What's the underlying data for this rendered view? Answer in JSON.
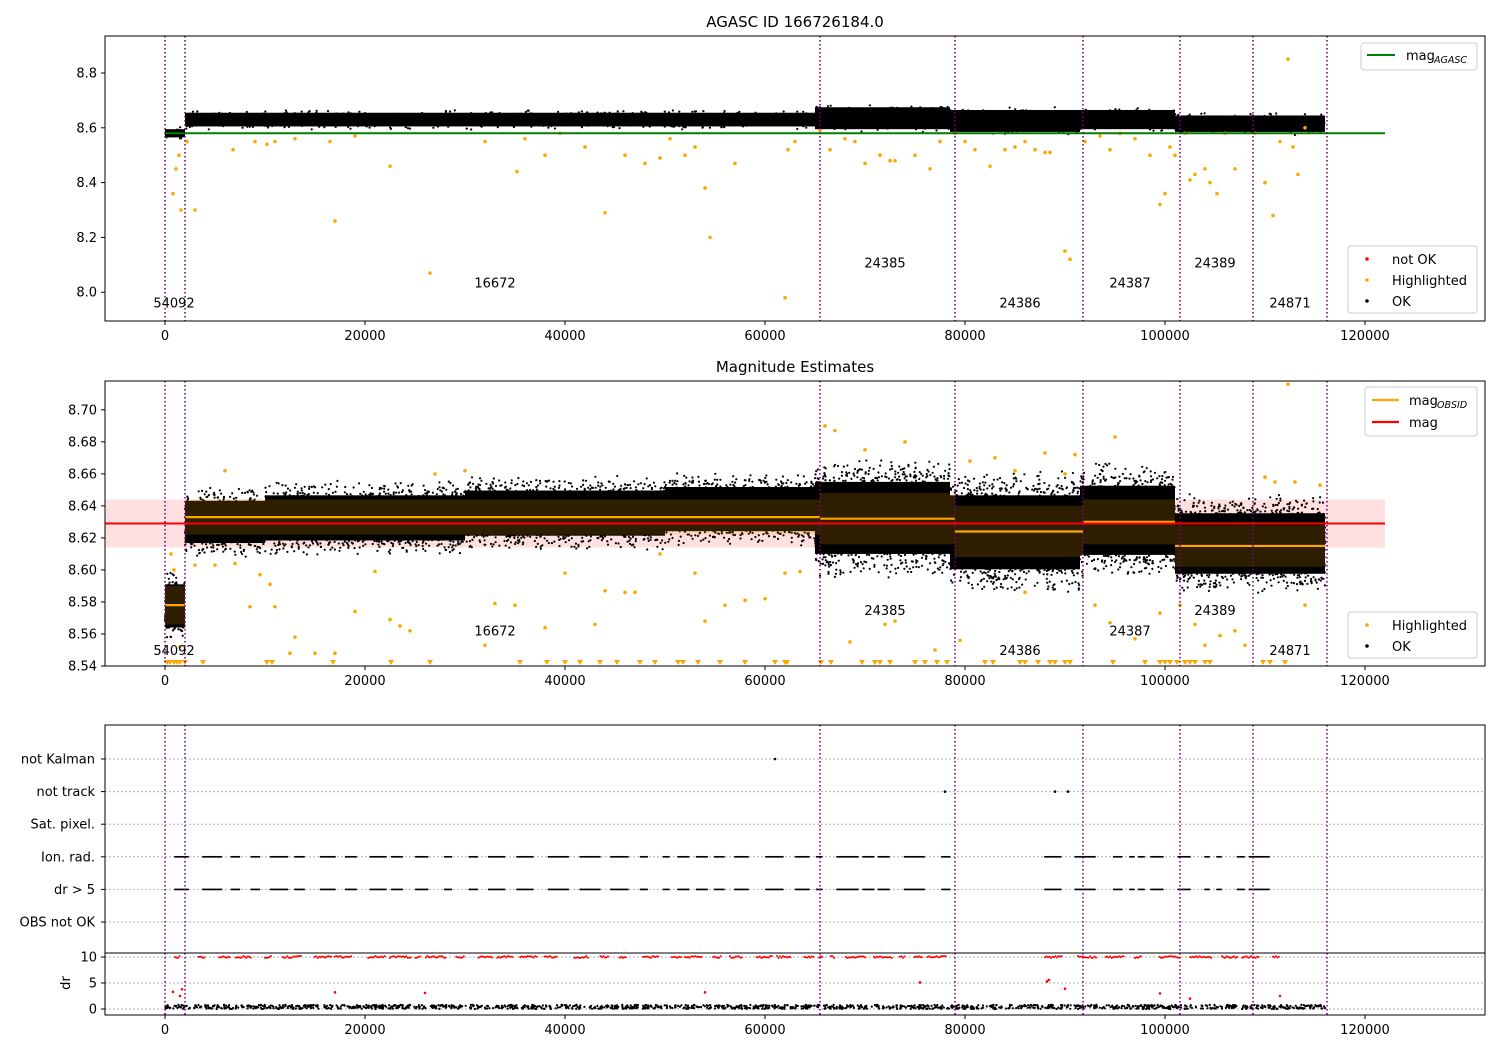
{
  "chart_data": [
    {
      "type": "scatter",
      "title": "AGASC ID 166726184.0",
      "xlim": [
        -6000,
        132000
      ],
      "ylim": [
        7.895,
        8.935
      ],
      "x_ticks": [
        0,
        20000,
        40000,
        60000,
        80000,
        100000,
        120000
      ],
      "y_ticks": [
        8.0,
        8.2,
        8.4,
        8.6,
        8.8
      ],
      "y_tick_labels": [
        "8.0",
        "8.2",
        "8.4",
        "8.6",
        "8.8"
      ],
      "mag_agasc": 8.58,
      "mag_agasc_range": [
        0,
        122000
      ],
      "legend_upper": {
        "position": "upper right",
        "entries": [
          {
            "label": "mag",
            "sub": "AGASC",
            "color": "#008000"
          }
        ]
      },
      "legend_lower": {
        "position": "lower right",
        "entries": [
          {
            "label": "not OK",
            "color": "#ff0000"
          },
          {
            "label": "Highlighted",
            "color": "#ffa500"
          },
          {
            "label": "OK",
            "color": "#000000"
          }
        ]
      },
      "obsid_labels": [
        {
          "text": "54092",
          "x": 900,
          "y": 7.945
        },
        {
          "text": "16672",
          "x": 33000,
          "y": 8.018
        },
        {
          "text": "24385",
          "x": 72000,
          "y": 8.09
        },
        {
          "text": "24386",
          "x": 85500,
          "y": 7.945
        },
        {
          "text": "24387",
          "x": 96500,
          "y": 8.018
        },
        {
          "text": "24389",
          "x": 105000,
          "y": 8.09
        },
        {
          "text": "24871",
          "x": 112500,
          "y": 7.945
        }
      ],
      "ok_bands": [
        {
          "x0": 0,
          "x1": 2000,
          "lo": 8.565,
          "hi": 8.595
        },
        {
          "x0": 2000,
          "x1": 65000,
          "lo": 8.605,
          "hi": 8.655
        },
        {
          "x0": 65000,
          "x1": 78500,
          "lo": 8.595,
          "hi": 8.675
        },
        {
          "x0": 78500,
          "x1": 91500,
          "lo": 8.585,
          "hi": 8.665
        },
        {
          "x0": 91500,
          "x1": 101000,
          "lo": 8.595,
          "hi": 8.665
        },
        {
          "x0": 101000,
          "x1": 116000,
          "lo": 8.585,
          "hi": 8.645
        }
      ],
      "highlighted_points": [
        [
          800,
          8.36
        ],
        [
          1100,
          8.45
        ],
        [
          1400,
          8.5
        ],
        [
          1600,
          8.3
        ],
        [
          2200,
          8.55
        ],
        [
          3000,
          8.3
        ],
        [
          6800,
          8.52
        ],
        [
          9000,
          8.55
        ],
        [
          10200,
          8.54
        ],
        [
          11000,
          8.55
        ],
        [
          13000,
          8.56
        ],
        [
          16500,
          8.55
        ],
        [
          17000,
          8.26
        ],
        [
          19000,
          8.57
        ],
        [
          22500,
          8.46
        ],
        [
          26500,
          8.07
        ],
        [
          32000,
          8.55
        ],
        [
          35200,
          8.44
        ],
        [
          36000,
          8.56
        ],
        [
          38000,
          8.5
        ],
        [
          39500,
          8.58
        ],
        [
          42000,
          8.53
        ],
        [
          44000,
          8.29
        ],
        [
          46000,
          8.5
        ],
        [
          48000,
          8.47
        ],
        [
          49500,
          8.49
        ],
        [
          50500,
          8.56
        ],
        [
          52000,
          8.5
        ],
        [
          53000,
          8.53
        ],
        [
          54000,
          8.38
        ],
        [
          54500,
          8.2
        ],
        [
          57000,
          8.47
        ],
        [
          62000,
          7.98
        ],
        [
          62300,
          8.52
        ],
        [
          63000,
          8.55
        ],
        [
          65500,
          8.59
        ],
        [
          66500,
          8.52
        ],
        [
          68000,
          8.56
        ],
        [
          69000,
          8.55
        ],
        [
          70000,
          8.47
        ],
        [
          71500,
          8.5
        ],
        [
          72500,
          8.48
        ],
        [
          73000,
          8.48
        ],
        [
          75000,
          8.5
        ],
        [
          76500,
          8.45
        ],
        [
          77500,
          8.55
        ],
        [
          79000,
          8.58
        ],
        [
          80000,
          8.55
        ],
        [
          81000,
          8.52
        ],
        [
          82500,
          8.46
        ],
        [
          84000,
          8.52
        ],
        [
          85000,
          8.53
        ],
        [
          86000,
          8.55
        ],
        [
          87000,
          8.52
        ],
        [
          88000,
          8.51
        ],
        [
          88500,
          8.51
        ],
        [
          90000,
          8.15
        ],
        [
          90500,
          8.12
        ],
        [
          92000,
          8.55
        ],
        [
          93500,
          8.57
        ],
        [
          94500,
          8.52
        ],
        [
          95500,
          8.58
        ],
        [
          97000,
          8.56
        ],
        [
          98500,
          8.5
        ],
        [
          99500,
          8.32
        ],
        [
          100000,
          8.36
        ],
        [
          100500,
          8.53
        ],
        [
          101000,
          8.5
        ],
        [
          102000,
          8.58
        ],
        [
          102500,
          8.41
        ],
        [
          103000,
          8.43
        ],
        [
          104000,
          8.45
        ],
        [
          104500,
          8.4
        ],
        [
          105200,
          8.36
        ],
        [
          106000,
          8.58
        ],
        [
          107000,
          8.45
        ],
        [
          109000,
          8.58
        ],
        [
          110000,
          8.4
        ],
        [
          110800,
          8.28
        ],
        [
          111500,
          8.55
        ],
        [
          112300,
          8.85
        ],
        [
          112800,
          8.53
        ],
        [
          113300,
          8.43
        ],
        [
          114000,
          8.6
        ]
      ]
    },
    {
      "type": "scatter",
      "title": "Magnitude Estimates",
      "xlim": [
        -6000,
        132000
      ],
      "ylim": [
        8.54,
        8.718
      ],
      "x_ticks": [
        0,
        20000,
        40000,
        60000,
        80000,
        100000,
        120000
      ],
      "y_ticks": [
        8.54,
        8.56,
        8.58,
        8.6,
        8.62,
        8.64,
        8.66,
        8.68,
        8.7
      ],
      "y_tick_labels": [
        "8.54",
        "8.56",
        "8.58",
        "8.60",
        "8.62",
        "8.64",
        "8.66",
        "8.68",
        "8.70"
      ],
      "mag": 8.629,
      "mag_band": [
        8.614,
        8.644
      ],
      "mag_range": [
        -6000,
        122000
      ],
      "mag_obsid_segments": [
        {
          "x0": 0,
          "x1": 2000,
          "y": 8.578,
          "lo": 8.566,
          "hi": 8.59
        },
        {
          "x0": 2000,
          "x1": 65500,
          "y": 8.633,
          "lo": 8.622,
          "hi": 8.644
        },
        {
          "x0": 65500,
          "x1": 79000,
          "y": 8.632,
          "lo": 8.616,
          "hi": 8.648
        },
        {
          "x0": 79000,
          "x1": 91800,
          "y": 8.624,
          "lo": 8.608,
          "hi": 8.64
        },
        {
          "x0": 91800,
          "x1": 101000,
          "y": 8.63,
          "lo": 8.616,
          "hi": 8.644
        },
        {
          "x0": 101000,
          "x1": 108500,
          "y": 8.615,
          "lo": 8.602,
          "hi": 8.628
        },
        {
          "x0": 108500,
          "x1": 116000,
          "y": 8.615,
          "lo": 8.602,
          "hi": 8.628
        }
      ],
      "legend_upper": {
        "position": "upper right",
        "entries": [
          {
            "label": "mag",
            "sub": "OBSID",
            "color": "#ffa500"
          },
          {
            "label": "mag",
            "sub": "",
            "color": "#ff0000"
          }
        ]
      },
      "legend_lower": {
        "position": "lower right",
        "entries": [
          {
            "label": "Highlighted",
            "color": "#ffa500"
          },
          {
            "label": "OK",
            "color": "#000000"
          }
        ]
      },
      "obsid_labels": [
        {
          "text": "54092",
          "x": 900,
          "y": 8.547
        },
        {
          "text": "16672",
          "x": 33000,
          "y": 8.559
        },
        {
          "text": "24385",
          "x": 72000,
          "y": 8.572
        },
        {
          "text": "24386",
          "x": 85500,
          "y": 8.547
        },
        {
          "text": "24387",
          "x": 96500,
          "y": 8.559
        },
        {
          "text": "24389",
          "x": 105000,
          "y": 8.572
        },
        {
          "text": "24871",
          "x": 112500,
          "y": 8.547
        }
      ],
      "ok_bands": [
        {
          "x0": 0,
          "x1": 2000,
          "lo": 8.555,
          "hi": 8.6
        },
        {
          "x0": 2000,
          "x1": 10000,
          "lo": 8.608,
          "hi": 8.652
        },
        {
          "x0": 10000,
          "x1": 30000,
          "lo": 8.609,
          "hi": 8.656
        },
        {
          "x0": 30000,
          "x1": 50000,
          "lo": 8.612,
          "hi": 8.659
        },
        {
          "x0": 50000,
          "x1": 65000,
          "lo": 8.615,
          "hi": 8.661
        },
        {
          "x0": 65000,
          "x1": 78500,
          "lo": 8.595,
          "hi": 8.67
        },
        {
          "x0": 78500,
          "x1": 91500,
          "lo": 8.585,
          "hi": 8.662
        },
        {
          "x0": 91500,
          "x1": 101000,
          "lo": 8.595,
          "hi": 8.667
        },
        {
          "x0": 101000,
          "x1": 116000,
          "lo": 8.585,
          "hi": 8.648
        }
      ],
      "highlighted_points": [
        [
          600,
          8.61
        ],
        [
          900,
          8.6
        ],
        [
          1500,
          8.552
        ],
        [
          3000,
          8.603
        ],
        [
          5000,
          8.603
        ],
        [
          6000,
          8.662
        ],
        [
          7000,
          8.604
        ],
        [
          8500,
          8.577
        ],
        [
          9500,
          8.597
        ],
        [
          10500,
          8.591
        ],
        [
          11000,
          8.577
        ],
        [
          12500,
          8.548
        ],
        [
          13000,
          8.558
        ],
        [
          15000,
          8.548
        ],
        [
          17000,
          8.548
        ],
        [
          19000,
          8.574
        ],
        [
          21000,
          8.599
        ],
        [
          22500,
          8.569
        ],
        [
          23500,
          8.565
        ],
        [
          24500,
          8.562
        ],
        [
          27000,
          8.66
        ],
        [
          30000,
          8.662
        ],
        [
          32000,
          8.553
        ],
        [
          33000,
          8.579
        ],
        [
          35000,
          8.578
        ],
        [
          38000,
          8.564
        ],
        [
          40000,
          8.598
        ],
        [
          43000,
          8.566
        ],
        [
          44000,
          8.587
        ],
        [
          46000,
          8.586
        ],
        [
          47000,
          8.586
        ],
        [
          49500,
          8.61
        ],
        [
          53000,
          8.598
        ],
        [
          54000,
          8.568
        ],
        [
          56000,
          8.578
        ],
        [
          58000,
          8.581
        ],
        [
          60000,
          8.582
        ],
        [
          62000,
          8.598
        ],
        [
          63500,
          8.599
        ],
        [
          66000,
          8.69
        ],
        [
          67000,
          8.687
        ],
        [
          70000,
          8.675
        ],
        [
          72000,
          8.566
        ],
        [
          68500,
          8.555
        ],
        [
          73000,
          8.568
        ],
        [
          74000,
          8.68
        ],
        [
          77000,
          8.55
        ],
        [
          79500,
          8.556
        ],
        [
          80500,
          8.668
        ],
        [
          83000,
          8.67
        ],
        [
          85000,
          8.662
        ],
        [
          86000,
          8.586
        ],
        [
          88000,
          8.673
        ],
        [
          90000,
          8.66
        ],
        [
          91000,
          8.672
        ],
        [
          93000,
          8.578
        ],
        [
          94500,
          8.567
        ],
        [
          95000,
          8.683
        ],
        [
          97000,
          8.557
        ],
        [
          99500,
          8.573
        ],
        [
          101500,
          8.578
        ],
        [
          103000,
          8.566
        ],
        [
          104000,
          8.553
        ],
        [
          105500,
          8.559
        ],
        [
          107000,
          8.562
        ],
        [
          108000,
          8.553
        ],
        [
          110000,
          8.658
        ],
        [
          111000,
          8.655
        ],
        [
          112300,
          8.716
        ],
        [
          113000,
          8.655
        ],
        [
          114000,
          8.578
        ],
        [
          115500,
          8.653
        ]
      ],
      "below_markers": [
        200,
        500,
        900,
        1200,
        1500,
        2000,
        3800,
        10200,
        10700,
        16800,
        22600,
        26500,
        35500,
        38200,
        40000,
        41500,
        43500,
        45200,
        47500,
        49000,
        51300,
        51800,
        53300,
        55500,
        58000,
        61000,
        62000,
        62200,
        65600,
        66600,
        69700,
        71000,
        71500,
        72500,
        75000,
        76000,
        77200,
        78200,
        82000,
        82800,
        85500,
        86000,
        87300,
        88500,
        89000,
        90000,
        90500,
        94800,
        98000,
        99500,
        100000,
        100500,
        101200,
        102000,
        102500,
        103000,
        104000,
        104500,
        109800,
        110500,
        112000
      ]
    },
    {
      "type": "scatter",
      "x_ticks": [
        0,
        20000,
        40000,
        60000,
        80000,
        100000,
        120000
      ],
      "xlim": [
        -6000,
        132000
      ],
      "flag_rows": [
        "not Kalman",
        "not track",
        "Sat. pixel.",
        "Ion. rad.",
        "dr > 5",
        "OBS not OK"
      ],
      "flag_points": [
        {
          "row": "not Kalman",
          "x": [
            61000
          ]
        },
        {
          "row": "not track",
          "x": [
            78000,
            89000,
            90300
          ]
        }
      ],
      "flag_segments": [
        {
          "rows": [
            "Ion. rad.",
            "dr > 5"
          ],
          "x0": 1000,
          "x1": 78500
        },
        {
          "rows": [
            "Ion. rad.",
            "dr > 5"
          ],
          "x0": 88000,
          "x1": 112000
        }
      ],
      "dr_axis": {
        "ylabel": "dr",
        "ylim": [
          -0.5,
          10.5
        ],
        "y_ticks": [
          0,
          5,
          10
        ]
      },
      "dr_highlight_points": [
        [
          800,
          3.3
        ],
        [
          1500,
          2.5
        ],
        [
          1700,
          3.8
        ],
        [
          17000,
          3.2
        ],
        [
          26000,
          3.1
        ],
        [
          54000,
          3.2
        ],
        [
          75500,
          5.1
        ],
        [
          88200,
          5.3
        ],
        [
          88400,
          5.6
        ],
        [
          90000,
          3.9
        ],
        [
          99500,
          3.0
        ],
        [
          102500,
          2.0
        ],
        [
          111500,
          2.5
        ]
      ]
    }
  ],
  "obsid_boundaries": [
    0,
    2000,
    65500,
    79000,
    91800,
    101500,
    108800,
    116200
  ]
}
